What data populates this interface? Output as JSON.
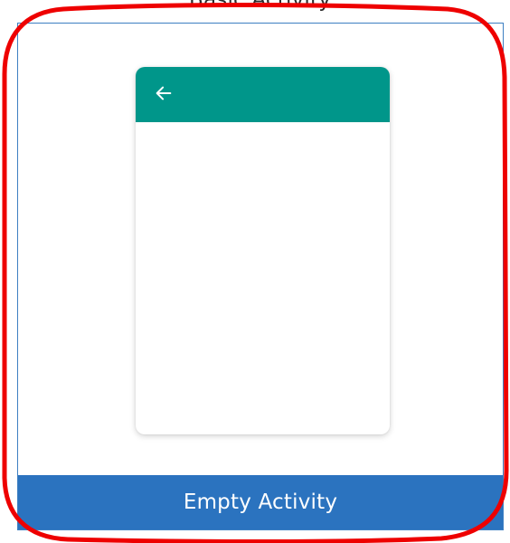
{
  "top_template": {
    "label": "Basic Activity"
  },
  "selected_template": {
    "label": "Empty Activity",
    "preview": {
      "appbar_color": "#00968a",
      "icon": "arrow-back-icon"
    }
  },
  "colors": {
    "selection_border": "#3d7fc2",
    "caption_background": "#2b73bf",
    "annotation": "#ee0000"
  }
}
